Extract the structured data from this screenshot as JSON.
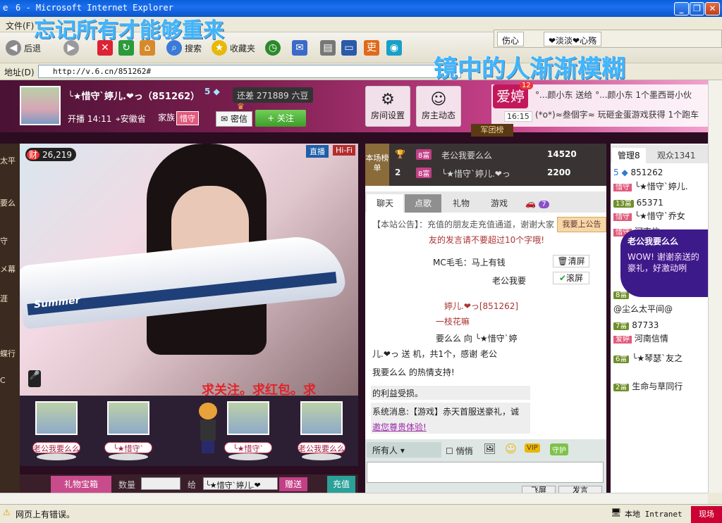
{
  "window": {
    "title": "6 - Microsoft Internet Explorer"
  },
  "menu": {
    "file": "文件(F)"
  },
  "toolbar": {
    "back": "后退",
    "search": "搜索",
    "favorites": "收藏夹"
  },
  "address": {
    "label": "地址(D)",
    "url": "http://v.6.cn/851262#"
  },
  "lyrics": {
    "line1": "忘记所有才能够重来",
    "line2": "镜中的人渐渐模糊"
  },
  "ie_tabs": [
    {
      "label": "伤心"
    },
    {
      "label": "❤淡淡❤心殇"
    }
  ],
  "room": {
    "host_name": "╰★惜守ˋ婷儿.❤っ（851262）",
    "host_level": "5",
    "need_text": "还差 271889 六豆",
    "show_time": "开播 14:11",
    "location": "安徽省",
    "family_label": "家族",
    "family_tag": "惜守",
    "message_btn": "密信",
    "follow_btn": "+ 关注",
    "room_settings": "房间设置",
    "host_news": "房主动态"
  },
  "fan": {
    "badge": "爱婷",
    "badge_count": "12",
    "time": "16:15",
    "line1": "°...颜小东 送给 °...颜小东 1个墨西哥小伙",
    "line2": "(*o*)≈叁個字≈ 玩砸金蛋游戏获得 1个跑车",
    "army": "军团榜"
  },
  "video": {
    "cai_count": "26,219",
    "live_tag": "直播",
    "hifi_tag": "Hi-Fi",
    "plane_label": "Summer",
    "marquee": "求关注。求红包。求"
  },
  "left_strip": [
    "太平",
    "要么",
    "守",
    "メ幕",
    "涯",
    "蝶行",
    "C"
  ],
  "seats": [
    {
      "name": "老公我要么么"
    },
    {
      "name": "╰★惜守ˋ"
    },
    {
      "name": "╰★惜守ˋ"
    },
    {
      "name": "老公我要么么"
    }
  ],
  "gift": {
    "box": "礼物宝箱",
    "qty": "数量",
    "to": "给",
    "to_value": "╰★惜守ˋ婷儿.❤",
    "send": "赠送",
    "recharge": "充值"
  },
  "rank": {
    "title": "本场榜单",
    "rows": [
      {
        "no": "1",
        "level": "8富",
        "name": "老公我要么么",
        "value": "14520"
      },
      {
        "no": "2",
        "level": "8富",
        "name": "╰★惜守ˋ婷儿.❤っ",
        "value": "2200"
      }
    ]
  },
  "chat": {
    "tabs": [
      "聊天",
      "点歌",
      "礼物",
      "游戏",
      "7"
    ],
    "announce_btn": "我要上公告",
    "lines": [
      "【本站公告】：充值的朋友走充值通道，谢谢大家",
      "友的发言请不要超过10个字哦!",
      "MC毛毛：马上有钱",
      "老公我要",
      "婷儿.❤っ[851262]",
      "一枝花嘛",
      "要么么 向 ╰★惜守ˋ婷",
      "儿.❤っ 送 机，共1个，感谢 老公",
      "我要么么 的热情支持!",
      "的利益受损。",
      "系统消息:【游戏】赤天首服送豪礼，诚",
      "邀您尊贵体验!"
    ],
    "clear_btn": "清屏",
    "scroll_btn": "滚屏",
    "recipient": "所有人",
    "whisper": "悄悄",
    "fly_btn": "飞屏",
    "send_btn": "发言"
  },
  "users": {
    "tab_admin": "管理8",
    "tab_viewers": "观众1341",
    "rows": [
      {
        "level": "5",
        "name": "851262"
      },
      {
        "level": "惜守",
        "name": "╰★惜守ˋ婷儿."
      },
      {
        "level": "13富",
        "name": "65371"
      },
      {
        "level": "惜守",
        "name": "╰★惜守ˋ乔女"
      },
      {
        "level": "惜守",
        "name": "河南信..."
      },
      {
        "level": "8富",
        "name": "@尘么太平间@"
      },
      {
        "level": "7富",
        "name": "87733"
      },
      {
        "level": "爱婷",
        "name": "河南信情"
      },
      {
        "level": "6富",
        "name": "╰★琴瑟ˋ友之"
      },
      {
        "level": "2富",
        "name": "生命与草同行"
      }
    ]
  },
  "bubble": {
    "name": "老公我要么么",
    "text": "WOW! 谢谢亲送的豪礼，好激动咧"
  },
  "status": {
    "text": "网页上有错误。",
    "zone": "本地 Intranet",
    "notice": "现场"
  },
  "colors": {
    "accent": "#c33f86",
    "titlebar": "#0a5fd8",
    "follow": "#3f9c2a"
  }
}
